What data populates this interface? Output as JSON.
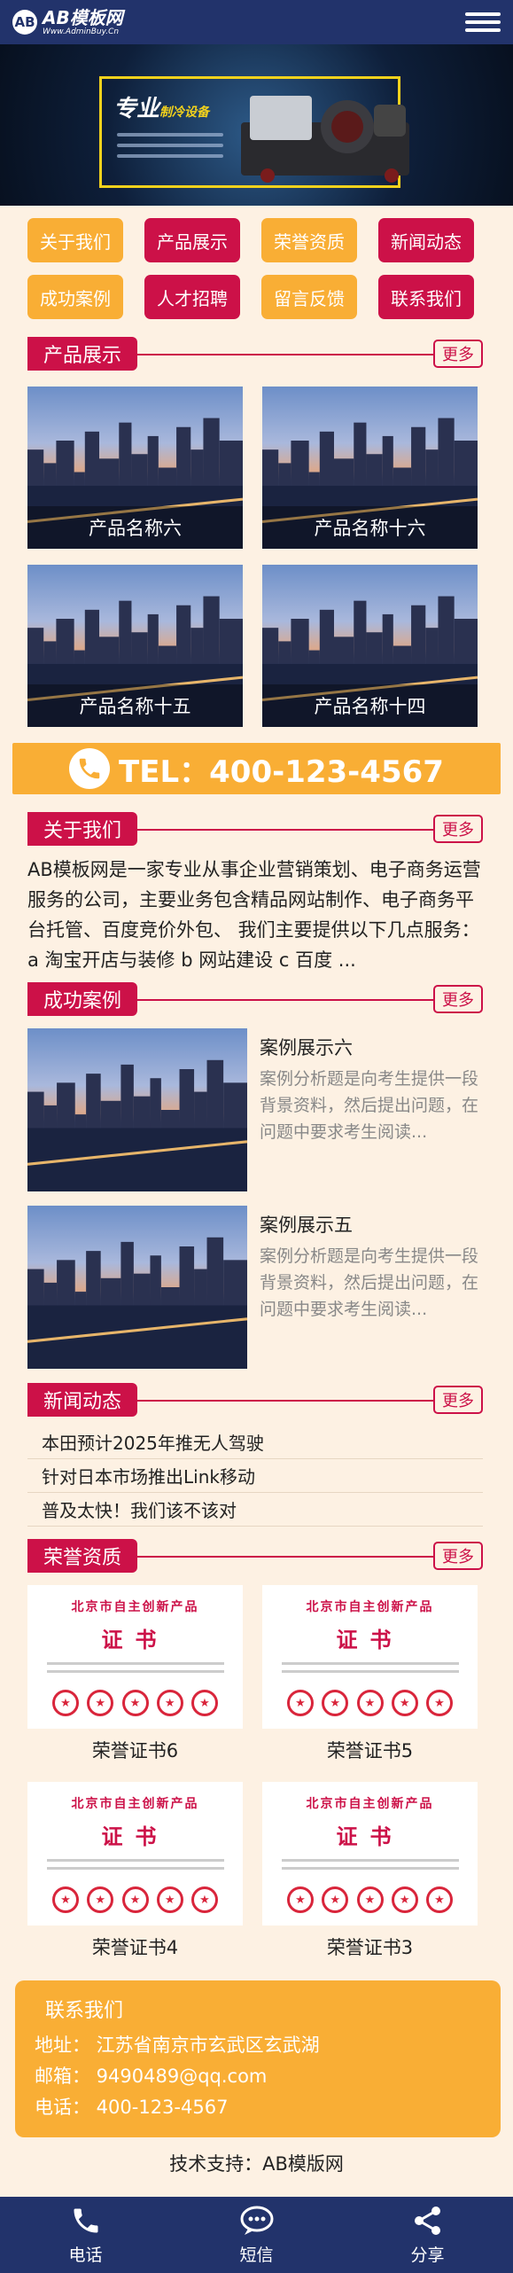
{
  "header": {
    "logo_mark": "AB",
    "logo_title": "AB模板网",
    "logo_sub": "Www.AdminBuy.Cn",
    "menu_icon": "hamburger-menu-icon"
  },
  "banner": {
    "slogan": "专业",
    "slogan_accent": "制冷设备"
  },
  "nav": [
    {
      "label": "关于我们",
      "color": "#f9ae35"
    },
    {
      "label": "产品展示",
      "color": "#cc1148"
    },
    {
      "label": "荣誉资质",
      "color": "#f9ae35"
    },
    {
      "label": "新闻动态",
      "color": "#cc1148"
    },
    {
      "label": "成功案例",
      "color": "#f9ae35"
    },
    {
      "label": "人才招聘",
      "color": "#cc1148"
    },
    {
      "label": "留言反馈",
      "color": "#f9ae35"
    },
    {
      "label": "联系我们",
      "color": "#cc1148"
    }
  ],
  "more_label": "更多",
  "products": {
    "title": "产品展示",
    "items": [
      {
        "name": "产品名称六"
      },
      {
        "name": "产品名称十六"
      },
      {
        "name": "产品名称十五"
      },
      {
        "name": "产品名称十四"
      }
    ]
  },
  "tel": {
    "text": "TEL：400-123-4567",
    "icon": "phone-icon"
  },
  "about": {
    "title": "关于我们",
    "text": "AB模板网是一家专业从事企业营销策划、电子商务运营服务的公司，主要业务包含精品网站制作、电子商务平台托管、百度竞价外包、 我们主要提供以下几点服务： a 淘宝开店与装修 b 网站建设 c 百度 ..."
  },
  "cases": {
    "title": "成功案例",
    "items": [
      {
        "title": "案例展示六",
        "desc": "案例分析题是向考生提供一段背景资料，然后提出问题，在问题中要求考生阅读..."
      },
      {
        "title": "案例展示五",
        "desc": "案例分析题是向考生提供一段背景资料，然后提出问题，在问题中要求考生阅读..."
      }
    ]
  },
  "news": {
    "title": "新闻动态",
    "items": [
      {
        "text": "本田预计2025年推无人驾驶"
      },
      {
        "text": "针对日本市场推出Link移动"
      },
      {
        "text": "普及太快！我们该不该对"
      }
    ]
  },
  "honors": {
    "title": "荣誉资质",
    "cert_org": "北京市自主创新产品",
    "cert_word": "证书",
    "items": [
      {
        "name": "荣誉证书6"
      },
      {
        "name": "荣誉证书5"
      },
      {
        "name": "荣誉证书4"
      },
      {
        "name": "荣誉证书3"
      }
    ]
  },
  "contact": {
    "title": "联系我们",
    "address": "地址： 江苏省南京市玄武区玄武湖",
    "email": "邮箱： 9490489@qq.com",
    "phone": "电话： 400-123-4567"
  },
  "support": "技术支持：AB模版网",
  "bottom_bar": [
    {
      "label": "电话",
      "icon": "phone-icon"
    },
    {
      "label": "短信",
      "icon": "message-icon"
    },
    {
      "label": "分享",
      "icon": "share-icon"
    }
  ],
  "colors": {
    "navy": "#22336b",
    "red": "#cc1148",
    "orange": "#f9ae35",
    "page_bg": "#fdf1e3"
  }
}
